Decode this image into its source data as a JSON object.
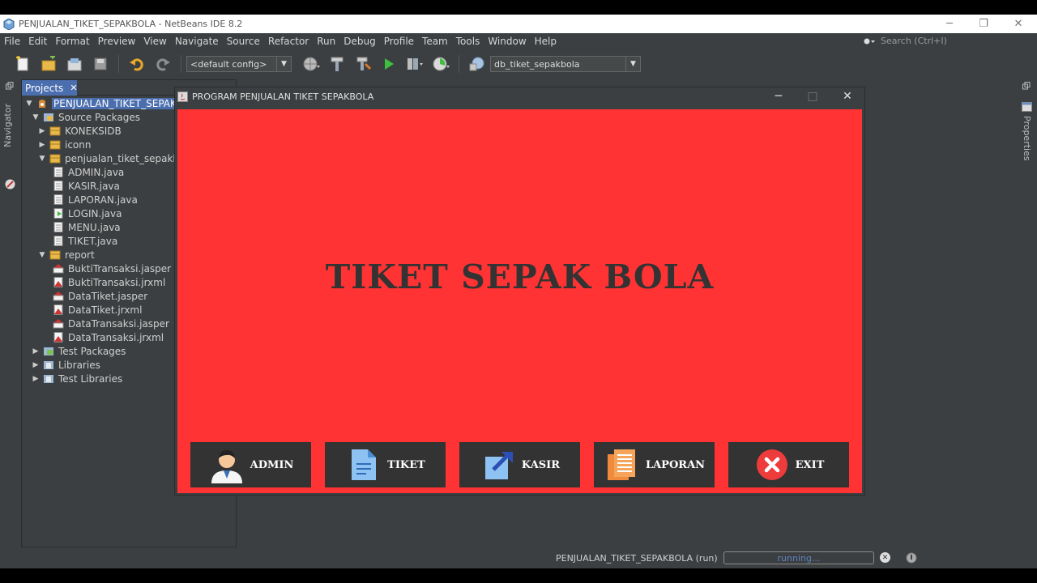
{
  "os_window": {
    "title": "PENJUALAN_TIKET_SEPAKBOLA - NetBeans IDE 8.2",
    "minimize": "─",
    "restore": "❐",
    "close": "✕"
  },
  "menu": {
    "items": [
      "File",
      "Edit",
      "Format",
      "Preview",
      "View",
      "Navigate",
      "Source",
      "Refactor",
      "Run",
      "Debug",
      "Profile",
      "Team",
      "Tools",
      "Window",
      "Help"
    ]
  },
  "search": {
    "placeholder": "Search (Ctrl+I)"
  },
  "toolbar": {
    "config_value": "<default config>",
    "db_value": "db_tiket_sepakbola",
    "combo_arrow": "▼"
  },
  "left_strip": {
    "navigator_label": "Navigator"
  },
  "right_strip": {
    "properties_label": "Properties"
  },
  "projects": {
    "tab_label": "Projects",
    "tab_close": "✕",
    "tree": [
      {
        "label": "PENJUALAN_TIKET_SEPAK",
        "toggle": "▼",
        "icon": "project-icon",
        "selected": true
      },
      {
        "label": "Source Packages",
        "toggle": "▼",
        "icon": "source-packages-icon"
      },
      {
        "label": "KONEKSIDB",
        "toggle": "▶",
        "icon": "package-icon"
      },
      {
        "label": "iconn",
        "toggle": "▶",
        "icon": "package-icon"
      },
      {
        "label": "penjualan_tiket_sepakbol",
        "toggle": "▼",
        "icon": "package-icon"
      },
      {
        "label": "ADMIN.java",
        "toggle": "",
        "icon": "java-file-icon"
      },
      {
        "label": "KASIR.java",
        "toggle": "",
        "icon": "java-file-icon"
      },
      {
        "label": "LAPORAN.java",
        "toggle": "",
        "icon": "java-file-icon"
      },
      {
        "label": "LOGIN.java",
        "toggle": "",
        "icon": "java-main-file-icon"
      },
      {
        "label": "MENU.java",
        "toggle": "",
        "icon": "java-file-icon"
      },
      {
        "label": "TIKET.java",
        "toggle": "",
        "icon": "java-file-icon"
      },
      {
        "label": "report",
        "toggle": "▼",
        "icon": "package-icon"
      },
      {
        "label": "BuktiTransaksi.jasper",
        "toggle": "",
        "icon": "jasper-file-icon"
      },
      {
        "label": "BuktiTransaksi.jrxml",
        "toggle": "",
        "icon": "jrxml-file-icon"
      },
      {
        "label": "DataTiket.jasper",
        "toggle": "",
        "icon": "jasper-file-icon"
      },
      {
        "label": "DataTiket.jrxml",
        "toggle": "",
        "icon": "jrxml-file-icon"
      },
      {
        "label": "DataTransaksi.jasper",
        "toggle": "",
        "icon": "jasper-file-icon"
      },
      {
        "label": "DataTransaksi.jrxml",
        "toggle": "",
        "icon": "jrxml-file-icon"
      },
      {
        "label": "Test Packages",
        "toggle": "▶",
        "icon": "test-packages-icon"
      },
      {
        "label": "Libraries",
        "toggle": "▶",
        "icon": "libraries-icon"
      },
      {
        "label": "Test Libraries",
        "toggle": "▶",
        "icon": "libraries-icon"
      }
    ]
  },
  "app_window": {
    "title": "PROGRAM PENJUALAN TIKET SEPAKBOLA",
    "minimize": "─",
    "maximize": "□",
    "close": "✕",
    "heading": "TIKET SEPAK BOLA",
    "panel_color": "#ff3333",
    "button_color": "#333333",
    "buttons": [
      {
        "label": "ADMIN",
        "icon": "admin-user-icon"
      },
      {
        "label": "TIKET",
        "icon": "document-icon"
      },
      {
        "label": "KASIR",
        "icon": "share-arrow-icon"
      },
      {
        "label": "LAPORAN",
        "icon": "report-icon"
      },
      {
        "label": "EXIT",
        "icon": "exit-x-icon"
      }
    ]
  },
  "status": {
    "run_label": "PENJUALAN_TIKET_SEPAKBOLA (run)",
    "progress_text": "running...",
    "cancel": "✕"
  }
}
